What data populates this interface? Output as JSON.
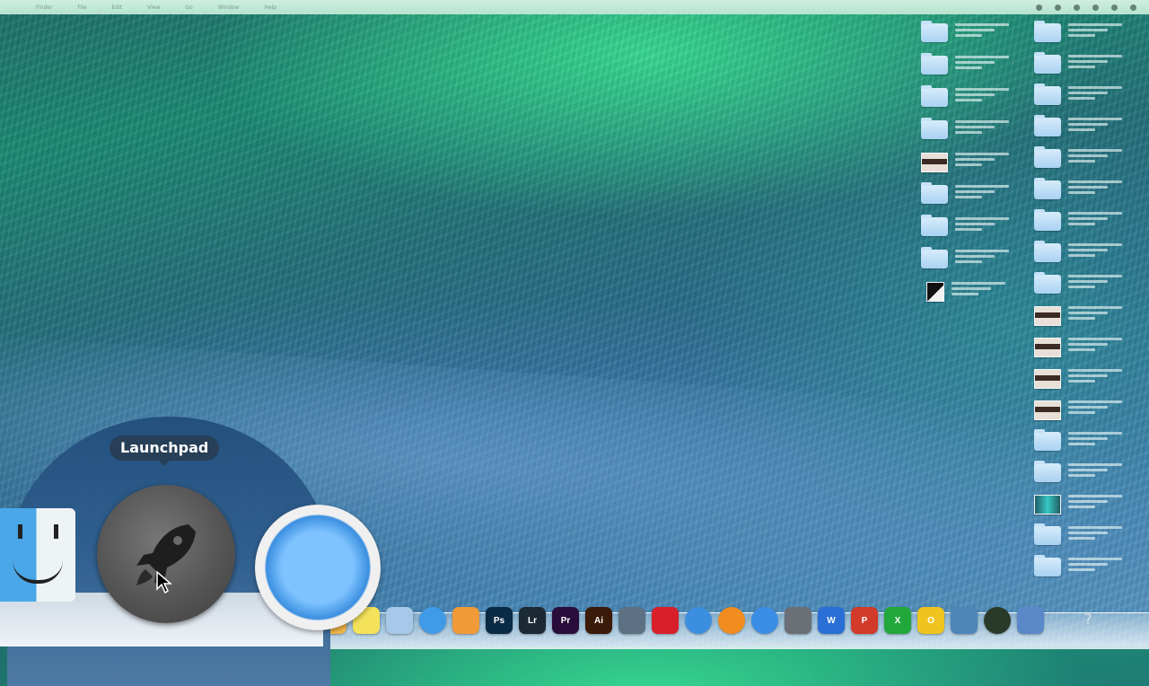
{
  "menubar": {
    "apple": "",
    "menus": [
      "Finder",
      "File",
      "Edit",
      "View",
      "Go",
      "Window",
      "Help"
    ]
  },
  "tooltip": {
    "label": "Launchpad"
  },
  "desktop": {
    "column1": [
      "folder",
      "folder",
      "folder",
      "folder",
      "image",
      "folder",
      "folder",
      "folder",
      "document"
    ],
    "column2": [
      "folder",
      "folder",
      "folder",
      "folder",
      "folder",
      "folder",
      "folder",
      "folder",
      "folder",
      "image",
      "image",
      "image",
      "image",
      "folder",
      "folder",
      "image-teal",
      "folder",
      "folder"
    ]
  },
  "dock": {
    "magnified": [
      "finder-icon",
      "launchpad-icon",
      "safari-icon"
    ],
    "apps": [
      {
        "name": "notes",
        "color": "#f2b84a",
        "label": ""
      },
      {
        "name": "stickies",
        "color": "#f3e25a",
        "label": ""
      },
      {
        "name": "photos",
        "color": "#a7c8e8",
        "label": ""
      },
      {
        "name": "app-store",
        "color": "#3f9be8",
        "label": ""
      },
      {
        "name": "folder-orange",
        "color": "#f09a3a",
        "label": ""
      },
      {
        "name": "photoshop",
        "color": "#0b2a44",
        "label": "Ps"
      },
      {
        "name": "lightroom",
        "color": "#1c2a35",
        "label": "Lr"
      },
      {
        "name": "premiere",
        "color": "#2a0c3a",
        "label": "Pr"
      },
      {
        "name": "illustrator",
        "color": "#3a1a08",
        "label": "Ai"
      },
      {
        "name": "camera",
        "color": "#5c7284",
        "label": ""
      },
      {
        "name": "red-app",
        "color": "#d8202a",
        "label": ""
      },
      {
        "name": "itunes",
        "color": "#3c8fe0",
        "label": ""
      },
      {
        "name": "orange-round",
        "color": "#f28c1e",
        "label": ""
      },
      {
        "name": "globe",
        "color": "#3a8ee6",
        "label": ""
      },
      {
        "name": "grey-app",
        "color": "#6a7076",
        "label": ""
      },
      {
        "name": "word",
        "color": "#2a6fd6",
        "label": "W"
      },
      {
        "name": "powerpoint",
        "color": "#d23a2a",
        "label": "P"
      },
      {
        "name": "excel",
        "color": "#22a83a",
        "label": "X"
      },
      {
        "name": "outlook",
        "color": "#f0c41e",
        "label": "O"
      },
      {
        "name": "tree-app",
        "color": "#4e86b8",
        "label": ""
      },
      {
        "name": "dark-round",
        "color": "#2a3a2a",
        "label": ""
      },
      {
        "name": "user-app",
        "color": "#5a88c8",
        "label": ""
      }
    ],
    "help": "?"
  }
}
